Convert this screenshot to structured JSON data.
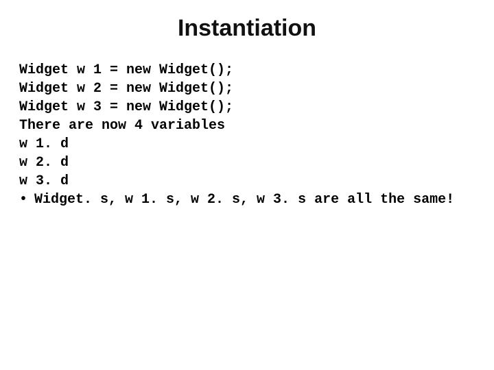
{
  "title": "Instantiation",
  "code_lines": {
    "l1": "Widget w 1 = new Widget();",
    "l2": "Widget w 2 = new Widget();",
    "l3": "Widget w 3 = new Widget();",
    "l4": "There are now 4 variables",
    "l5": "w 1. d",
    "l6": "w 2. d",
    "l7": "w 3. d"
  },
  "bullet": {
    "dot": "•",
    "text": "Widget. s, w 1. s, w 2. s, w 3. s are all the same!"
  }
}
